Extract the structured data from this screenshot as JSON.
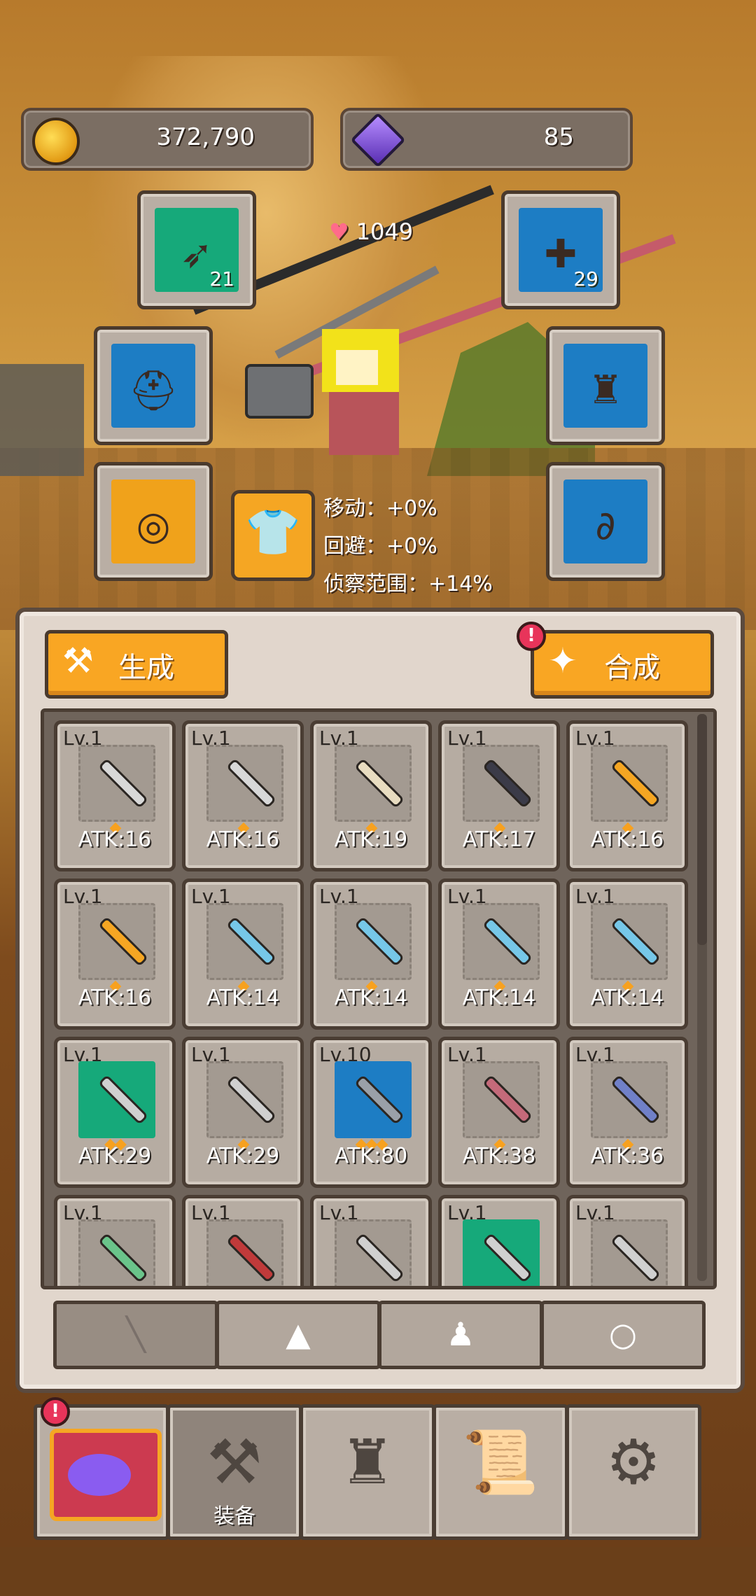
{
  "currency": {
    "gold": "372,790",
    "gems": "85"
  },
  "hero": {
    "hp": "1049"
  },
  "slots": {
    "weapon_left_count": "21",
    "weapon_right_count": "29"
  },
  "stats": [
    "移动：+0%",
    "回避：+0%",
    "侦察范围：+14%"
  ],
  "buttons": {
    "generate": "生成",
    "combine": "合成",
    "combine_badge": "!"
  },
  "items": [
    {
      "lv": "Lv.1",
      "atk": "ATK:16",
      "stars": "◆",
      "color": "#d8d8d8"
    },
    {
      "lv": "Lv.1",
      "atk": "ATK:16",
      "stars": "◆",
      "color": "#d8d8d8"
    },
    {
      "lv": "Lv.1",
      "atk": "ATK:19",
      "stars": "◆",
      "color": "#e8dcc0"
    },
    {
      "lv": "Lv.1",
      "atk": "ATK:17",
      "stars": "◆",
      "color": "#3b3b48"
    },
    {
      "lv": "Lv.1",
      "atk": "ATK:16",
      "stars": "◆",
      "color": "#f5a623"
    },
    {
      "lv": "Lv.1",
      "atk": "ATK:16",
      "stars": "◆",
      "color": "#f5a623"
    },
    {
      "lv": "Lv.1",
      "atk": "ATK:14",
      "stars": "◆",
      "color": "#76c7e8"
    },
    {
      "lv": "Lv.1",
      "atk": "ATK:14",
      "stars": "◆",
      "color": "#76c7e8"
    },
    {
      "lv": "Lv.1",
      "atk": "ATK:14",
      "stars": "◆",
      "color": "#76c7e8"
    },
    {
      "lv": "Lv.1",
      "atk": "ATK:14",
      "stars": "◆",
      "color": "#76c7e8"
    },
    {
      "lv": "Lv.1",
      "atk": "ATK:29",
      "stars": "◆◆",
      "color": "#d0d0d0",
      "bg": "g"
    },
    {
      "lv": "Lv.1",
      "atk": "ATK:29",
      "stars": "◆",
      "color": "#d0d0d0"
    },
    {
      "lv": "Lv.10",
      "atk": "ATK:80",
      "stars": "◆◆◆",
      "color": "#9aa0a8",
      "bg": "b"
    },
    {
      "lv": "Lv.1",
      "atk": "ATK:38",
      "stars": "◆",
      "color": "#c46a7a"
    },
    {
      "lv": "Lv.1",
      "atk": "ATK:36",
      "stars": "◆",
      "color": "#7080c8"
    },
    {
      "lv": "Lv.1",
      "atk": "",
      "stars": "◆",
      "color": "#6ac48a"
    },
    {
      "lv": "Lv.1",
      "atk": "",
      "stars": "",
      "color": "#c03a3a"
    },
    {
      "lv": "Lv.1",
      "atk": "",
      "stars": "",
      "color": "#d0d0d0"
    },
    {
      "lv": "Lv.1",
      "atk": "",
      "stars": "◆◆",
      "color": "#d0d0d0",
      "bg": "g"
    },
    {
      "lv": "Lv.1",
      "atk": "",
      "stars": "",
      "color": "#d0d0d0"
    }
  ],
  "tabs": [
    {
      "name": "tab-weapons",
      "glyph": "╲"
    },
    {
      "name": "tab-horse",
      "glyph": "▲"
    },
    {
      "name": "tab-armor",
      "glyph": "♟"
    },
    {
      "name": "tab-ring",
      "glyph": "○"
    }
  ],
  "nav": {
    "equip_label": "装备",
    "shop_badge": "!"
  },
  "icons": {
    "gold": "coin-icon",
    "gems": "gem-icon",
    "heart": "♥",
    "generate": "hammer-icon",
    "combine": "sparkle-icon"
  }
}
